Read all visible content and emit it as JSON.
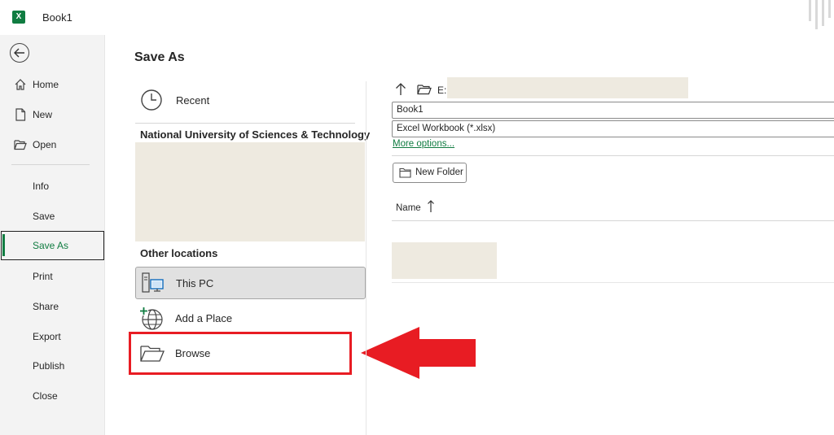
{
  "titlebar": {
    "app_icon": "excel-icon",
    "app_letter": "X",
    "document_title": "Book1"
  },
  "nav": {
    "back_icon": "back-arrow-icon",
    "items_top": [
      {
        "label": "Home",
        "icon": "home-icon"
      },
      {
        "label": "New",
        "icon": "new-document-icon"
      },
      {
        "label": "Open",
        "icon": "open-folder-icon"
      }
    ],
    "items_bottom": [
      {
        "label": "Info"
      },
      {
        "label": "Save"
      },
      {
        "label": "Save As",
        "active": true
      },
      {
        "label": "Print"
      },
      {
        "label": "Share"
      },
      {
        "label": "Export"
      },
      {
        "label": "Publish"
      },
      {
        "label": "Close"
      }
    ]
  },
  "main": {
    "title": "Save As",
    "recent": {
      "label": "Recent",
      "icon": "clock-icon"
    },
    "organization": "National University of Sciences & Technology",
    "other_locations_heading": "Other locations",
    "locations": [
      {
        "label": "This PC",
        "icon": "this-pc-icon",
        "selected": true
      },
      {
        "label": "Add a Place",
        "icon": "add-place-globe-icon"
      },
      {
        "label": "Browse",
        "icon": "browse-folder-icon",
        "highlighted": true
      }
    ]
  },
  "save_panel": {
    "path_prefix": "E:",
    "file_name": "Book1",
    "file_type": "Excel Workbook (*.xlsx)",
    "more_options": "More options...",
    "new_folder": "New Folder",
    "column_name": "Name"
  },
  "annotation": {
    "highlight_color": "#e81c23",
    "arrow_color": "#e81c23"
  },
  "colors": {
    "accent": "#107c41",
    "redaction": "#eeeae0"
  }
}
